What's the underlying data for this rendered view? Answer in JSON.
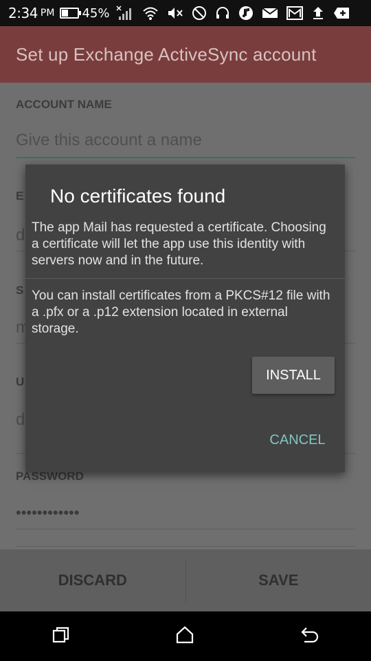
{
  "status_bar": {
    "time": "2:34",
    "ampm": "PM",
    "battery": "45%",
    "icons": [
      "battery-icon",
      "signal-icon",
      "wifi-icon",
      "mute-icon",
      "do-not-disturb-icon",
      "headset-icon",
      "music-icon",
      "mail-icon",
      "gmail-icon",
      "upload-icon",
      "add-icon"
    ]
  },
  "app_bar": {
    "title": "Set up Exchange ActiveSync account"
  },
  "form": {
    "account_name_label": "ACCOUNT NAME",
    "account_name_placeholder": "Give this account a name",
    "email_label_partial": "E",
    "email_value_partial": "d",
    "server_label_partial": "S",
    "server_value_partial": "m",
    "user_label_partial": "U",
    "user_value_partial": "d",
    "password_label": "PASSWORD",
    "password_value": "••••••••••••"
  },
  "action_bar": {
    "discard": "DISCARD",
    "save": "SAVE"
  },
  "dialog": {
    "title": "No certificates found",
    "message1": "The app Mail has requested a certificate. Choosing a certificate will let the app use this identity with servers now and in the future.",
    "message2": "You can install certificates from a PKCS#12 file with a .pfx or a .p12 extension located in external storage.",
    "install": "INSTALL",
    "cancel": "CANCEL"
  },
  "nav_bar": {
    "icons": [
      "recents-icon",
      "home-icon",
      "back-icon"
    ]
  },
  "colors": {
    "accent": "#7fc7bf",
    "app_bar": "#7a3d3d",
    "dialog": "#424242"
  }
}
